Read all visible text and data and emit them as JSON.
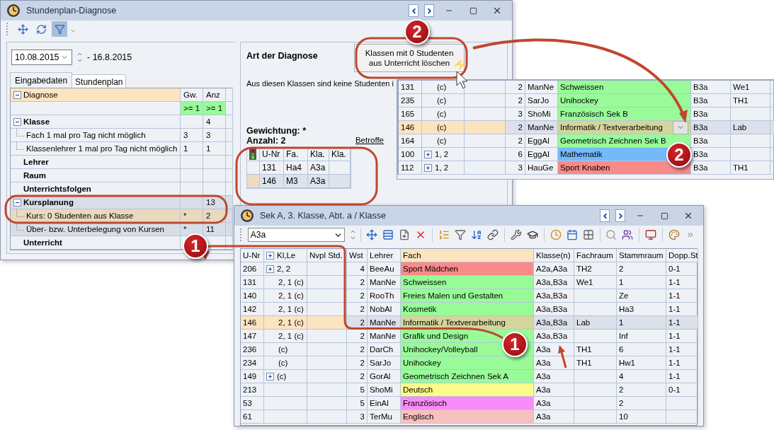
{
  "diagnosis_window": {
    "title": "Stundenplan-Diagnose",
    "toolbar": [
      {
        "kind": "move",
        "pressed": false
      },
      {
        "kind": "refresh",
        "pressed": false
      },
      {
        "kind": "filter",
        "pressed": true
      }
    ],
    "date_from": "10.08.2015",
    "date_to": "- 16.8.2015",
    "tabs": [
      {
        "label": "Eingabedaten",
        "selected": true
      },
      {
        "label": "Stundenplan",
        "selected": false
      }
    ],
    "tree": {
      "columns": [
        "Diagnose",
        "Gw.",
        "Anz"
      ],
      "filter": [
        ">= 1",
        ">= 1"
      ],
      "rows": [
        {
          "label": "Klasse",
          "anz": "4",
          "expanded": true,
          "children": [
            {
              "label": "Fach 1 mal pro Tag nicht möglich",
              "gw": "3",
              "anz": "3",
              "selected": false
            },
            {
              "label": "Klassenlehrer 1 mal pro Tag nicht möglich",
              "gw": "1",
              "anz": "1",
              "selected": false
            }
          ]
        },
        {
          "label": "Lehrer"
        },
        {
          "label": "Raum"
        },
        {
          "label": "Unterrichtsfolgen"
        },
        {
          "label": "Kursplanung",
          "anz": "13",
          "expanded": true,
          "children": [
            {
              "label": "Kurs: 0 Studenten aus Klasse",
              "gw": "*",
              "anz": "2",
              "selected": true
            },
            {
              "label": "Über- bzw. Unterbelegung von Kursen",
              "gw": "*",
              "anz": "11",
              "selected": false
            }
          ]
        },
        {
          "label": "Unterricht"
        }
      ]
    },
    "detail": {
      "heading": "Art der Diagnose",
      "action_button": "Klassen mit 0 Studenten aus Unterricht löschen",
      "description": "Aus diesen Klassen sind keine Studenten i",
      "weighting": "Gewichtung: *",
      "count": "Anzahl: 2",
      "link": "Betroffe",
      "table": {
        "columns": [
          "U-Nr",
          "Fa.",
          "Kla.",
          "Kla."
        ],
        "rows": [
          {
            "u_nr": "131",
            "fa": "Ha4",
            "kla": "A3a",
            "selected": false
          },
          {
            "u_nr": "146",
            "fa": "M3",
            "kla": "A3a",
            "selected": true
          }
        ]
      }
    }
  },
  "class_b_lessons": {
    "rows": [
      {
        "u_nr": "131",
        "kl": "(c)",
        "wst": "2",
        "lehrer": "ManNe",
        "fach": "Schweissen",
        "color": "#98fb98",
        "klasse": "B3a",
        "fachraum": "We1",
        "group": false,
        "selected": false
      },
      {
        "u_nr": "235",
        "kl": "(c)",
        "wst": "2",
        "lehrer": "SarJo",
        "fach": "Unihockey",
        "color": "#98fb98",
        "klasse": "B3a",
        "fachraum": "TH1",
        "group": false,
        "selected": false
      },
      {
        "u_nr": "165",
        "kl": "(c)",
        "wst": "3",
        "lehrer": "ShoMi",
        "fach": "Französisch Sek B",
        "color": "#98fb98",
        "klasse": "B3a",
        "group": false,
        "selected": false
      },
      {
        "u_nr": "146",
        "kl": "(c)",
        "wst": "2",
        "lehrer": "ManNe",
        "fach": "Informatik / Textverarbeitung",
        "color": "#d3d59c",
        "klasse": "B3a",
        "fachraum": "Lab",
        "group": false,
        "selected": true
      },
      {
        "u_nr": "164",
        "kl": "(c)",
        "wst": "2",
        "lehrer": "EggAl",
        "fach": "Geometrisch Zeichnen Sek B",
        "color": "#98fb98",
        "klasse": "B3a",
        "group": false,
        "selected": false
      },
      {
        "u_nr": "100",
        "kl": "1, 2",
        "wst": "6",
        "lehrer": "EggAl",
        "fach": "Mathematik",
        "color": "#75b9fb",
        "klasse": "B3a",
        "group": true,
        "selected": false
      },
      {
        "u_nr": "112",
        "kl": "1, 2",
        "wst": "3",
        "lehrer": "HauGe",
        "fach": "Sport Knaben",
        "color": "#f88a8a",
        "klasse": "B3a",
        "fachraum": "TH1",
        "group": true,
        "selected": false
      }
    ]
  },
  "lesson_window": {
    "title": "Sek A, 3. Klasse, Abt. a / Klasse",
    "class_field": "A3a",
    "columns": [
      "U-Nr",
      "Kl,Le",
      "Nvpl Std.",
      "Wst",
      "Lehrer",
      "Fach",
      "Klasse(n)",
      "Fachraum",
      "Stammraum",
      "Dopp.St"
    ],
    "rows": [
      {
        "u_nr": "206",
        "kl_le": "2, 2",
        "wst": "4",
        "lehrer": "BeeAu",
        "fach": "Sport Mädchen",
        "color": "#f88a8a",
        "klasse": "A2a,A3a",
        "fachraum": "TH2",
        "stammraum": "2",
        "dopp": "0-1",
        "group": true,
        "selected": false
      },
      {
        "u_nr": "131",
        "kl_le": "2, 1 (c)",
        "wst": "2",
        "lehrer": "ManNe",
        "fach": "Schweissen",
        "color": "#98fb98",
        "klasse": "A3a,B3a",
        "fachraum": "We1",
        "stammraum": "1",
        "dopp": "1-1",
        "group": false,
        "selected": false
      },
      {
        "u_nr": "140",
        "kl_le": "2, 1 (c)",
        "wst": "2",
        "lehrer": "RooTh",
        "fach": "Freies Malen und Gestalten",
        "color": "#98fb98",
        "klasse": "A3a,B3a",
        "stammraum": "Ze",
        "dopp": "1-1",
        "group": false,
        "selected": false
      },
      {
        "u_nr": "142",
        "kl_le": "2, 1 (c)",
        "wst": "2",
        "lehrer": "NobAl",
        "fach": "Kosmetik",
        "color": "#98fb98",
        "klasse": "A3a,B3a",
        "stammraum": "Ha3",
        "dopp": "1-1",
        "group": false,
        "selected": false
      },
      {
        "u_nr": "146",
        "kl_le": "2, 1 (c)",
        "wst": "2",
        "lehrer": "ManNe",
        "fach": "Informatik / Textverarbeitung",
        "color": "#d3d59c",
        "klasse": "A3a,B3a",
        "fachraum": "Lab",
        "stammraum": "1",
        "dopp": "1-1",
        "group": false,
        "selected": true
      },
      {
        "u_nr": "147",
        "kl_le": "2, 1 (c)",
        "wst": "2",
        "lehrer": "ManNe",
        "fach": "Grafik und Design",
        "color": "#98fb98",
        "klasse": "A3a,B3a",
        "stammraum": "Inf",
        "dopp": "1-1",
        "group": false,
        "selected": false
      },
      {
        "u_nr": "236",
        "kl_le": "(c)",
        "wst": "2",
        "lehrer": "DarCh",
        "fach": "Unihockey/Volleyball",
        "color": "#98fb98",
        "klasse": "A3a",
        "fachraum": "TH1",
        "stammraum": "6",
        "dopp": "1-1",
        "group": false,
        "selected": false
      },
      {
        "u_nr": "234",
        "kl_le": "(c)",
        "wst": "2",
        "lehrer": "SarJo",
        "fach": "Unihockey",
        "color": "#98fb98",
        "klasse": "A3a",
        "fachraum": "TH1",
        "stammraum": "Hw1",
        "dopp": "1-1",
        "group": false,
        "selected": false
      },
      {
        "u_nr": "149",
        "kl_le": "(c)",
        "wst": "2",
        "lehrer": "GorAl",
        "fach": "Geometrisch Zeichnen Sek A",
        "color": "#98fb98",
        "klasse": "A3a",
        "stammraum": "4",
        "dopp": "1-1",
        "group": true,
        "selected": false
      },
      {
        "u_nr": "213",
        "wst": "5",
        "lehrer": "ShoMi",
        "fach": "Deutsch",
        "color": "#fbfb8c",
        "klasse": "A3a",
        "stammraum": "2",
        "dopp": "0-1",
        "group": false,
        "selected": false
      },
      {
        "u_nr": "53",
        "wst": "5",
        "lehrer": "EinAl",
        "fach": "Französisch",
        "color": "#f98cf9",
        "klasse": "A3a",
        "stammraum": "2",
        "group": false,
        "selected": false
      },
      {
        "u_nr": "61",
        "wst": "3",
        "lehrer": "TerMu",
        "fach": "Englisch",
        "color": "#f9c0c0",
        "klasse": "A3a",
        "stammraum": "10",
        "group": false,
        "selected": false
      }
    ]
  },
  "callouts": [
    {
      "label": "2"
    },
    {
      "label": "2"
    },
    {
      "label": "1"
    },
    {
      "label": "1"
    }
  ]
}
